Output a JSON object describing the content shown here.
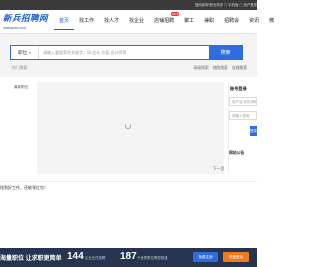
{
  "topbar": {
    "links_text": "搜尚新闻 职业测评 ▢ 手机版 ▢ 用户登录"
  },
  "logo": {
    "name": "新兵招聘网",
    "url": "xinbzpw.com"
  },
  "nav": {
    "items": [
      {
        "label": "首页",
        "active": true
      },
      {
        "label": "找工作"
      },
      {
        "label": "找人才"
      },
      {
        "label": "找企业"
      },
      {
        "label": "店铺招聘"
      },
      {
        "label": "聚工"
      },
      {
        "label": "兼职"
      },
      {
        "label": "招聘会"
      },
      {
        "label": "资讯"
      },
      {
        "label": "微"
      }
    ],
    "badge": "HOT"
  },
  "search": {
    "category": "职位",
    "placeholder": "请输入要搜索的关键字，如:会计,仓管,设计师等",
    "button_label": "搜索",
    "hot_label": "热门搜索:",
    "quick_links": [
      "高级搜索",
      "地图搜索",
      "店铺搜索"
    ]
  },
  "main": {
    "left_title": "最新职位",
    "pager": "下一页"
  },
  "login": {
    "title": "账号登录",
    "username_placeholder": "用户名/手机/邮箱",
    "password_placeholder": "请输入密码",
    "button_label": "登录"
  },
  "notice": {
    "title": "网站公告"
  },
  "bottom": {
    "text": "找到好工作，还能领红包！"
  },
  "footer": {
    "slogan": "海量职位 让求职更简单",
    "stats": [
      {
        "value": "144",
        "label": "企业正在招聘"
      },
      {
        "value": "187",
        "label": "个优质职位等您投递"
      }
    ],
    "primary_button": "免费注册",
    "secondary_button": "快速登录"
  },
  "colors": {
    "accent": "#2e6de0",
    "orange": "#f07a1f",
    "footer_bg": "#26344f"
  }
}
